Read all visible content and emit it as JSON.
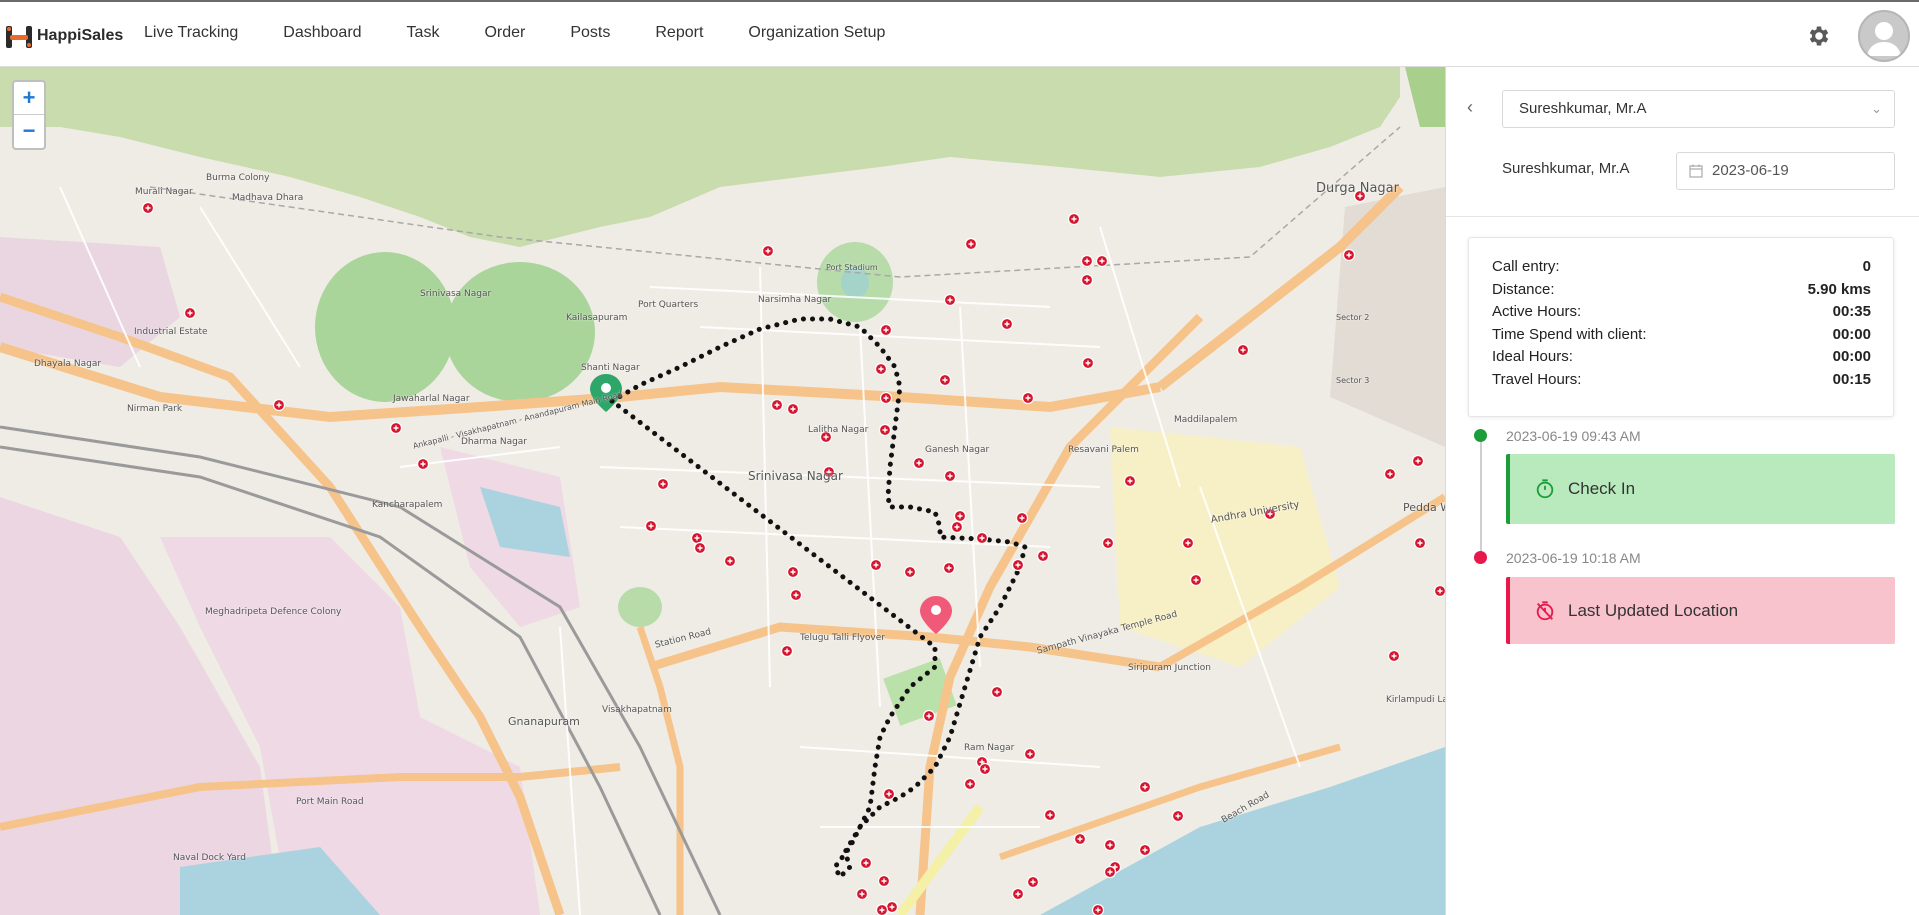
{
  "app": {
    "name": "HappiSales"
  },
  "nav": {
    "items": [
      "Live Tracking",
      "Dashboard",
      "Task",
      "Order",
      "Posts",
      "Report",
      "Organization Setup"
    ]
  },
  "header_icons": {
    "settings": "gear-icon",
    "profile": "avatar-icon"
  },
  "map": {
    "zoom_in": "+",
    "zoom_out": "−",
    "labels": {
      "durga_nagar": "Durga Nagar",
      "murali_nagar": "Murali Nagar",
      "burma_colony": "Burma Colony",
      "madhava_dhara": "Madhava Dhara",
      "industrial_estate": "Industrial Estate",
      "srinivasa_nagar_n": "Srinivasa Nagar",
      "kailasapuram": "Kailasapuram",
      "port_quarters": "Port Quarters",
      "narsimha_nagar": "Narsimha Nagar",
      "port_stadium": "Port Stadium",
      "shanti_nagar": "Shanti Nagar",
      "dhayala_nagar": "Dhayala Nagar",
      "nirman_park": "Nirman Park",
      "jawaharlal_nagar": "Jawaharlal Nagar",
      "dharma_nagar": "Dharma Nagar",
      "lalitha_nagar": "Lalitha Nagar",
      "srinivasa_nagar": "Srinivasa Nagar",
      "ganesh_nagar": "Ganesh Nagar",
      "resavani_palem": "Resavani Palem",
      "maddilapalem": "Maddilapalem",
      "andhra_university": "Andhra University",
      "kancharapalem": "Kancharapalem",
      "meghadripeta": "Meghadripeta Defence Colony",
      "gnanapuram": "Gnanapuram",
      "visakhapatnam": "Visakhapatnam",
      "ram_nagar": "Ram Nagar",
      "pedda_waltair": "Pedda Walt",
      "naval_dock": "Naval Dock Yard",
      "siripuram": "Siripuram Junction",
      "kirlampudi": "Kirlampudi Layout",
      "sector_2": "Sector 2",
      "sector_3": "Sector 3",
      "main_road": "Ankapalli - Visakhapatnam - Anandapuram Main Road",
      "station_road": "Station Road",
      "telugu_talli": "Telugu Talli Flyover",
      "port_main_road": "Port Main Road",
      "sampath_road": "Sampath Vinayaka Temple Road",
      "beach_road": "Beach Road"
    }
  },
  "panel": {
    "selected_employee": "Sureshkumar,  Mr.A",
    "employee_name": "Sureshkumar,  Mr.A",
    "date": "2023-06-19",
    "stats": [
      {
        "label": "Call entry:",
        "value": "0"
      },
      {
        "label": "Distance:",
        "value": "5.90 kms"
      },
      {
        "label": "Active Hours:",
        "value": "00:35"
      },
      {
        "label": "Time Spend with client:",
        "value": "00:00"
      },
      {
        "label": "Ideal Hours:",
        "value": "00:00"
      },
      {
        "label": "Travel Hours:",
        "value": "00:15"
      }
    ],
    "timeline": [
      {
        "time": "2023-06-19 09:43 AM",
        "title": "Check In",
        "status_color": "#1b9e3a"
      },
      {
        "time": "2023-06-19 10:18 AM",
        "title": "Last Updated Location",
        "status_color": "#e8184c"
      }
    ]
  }
}
